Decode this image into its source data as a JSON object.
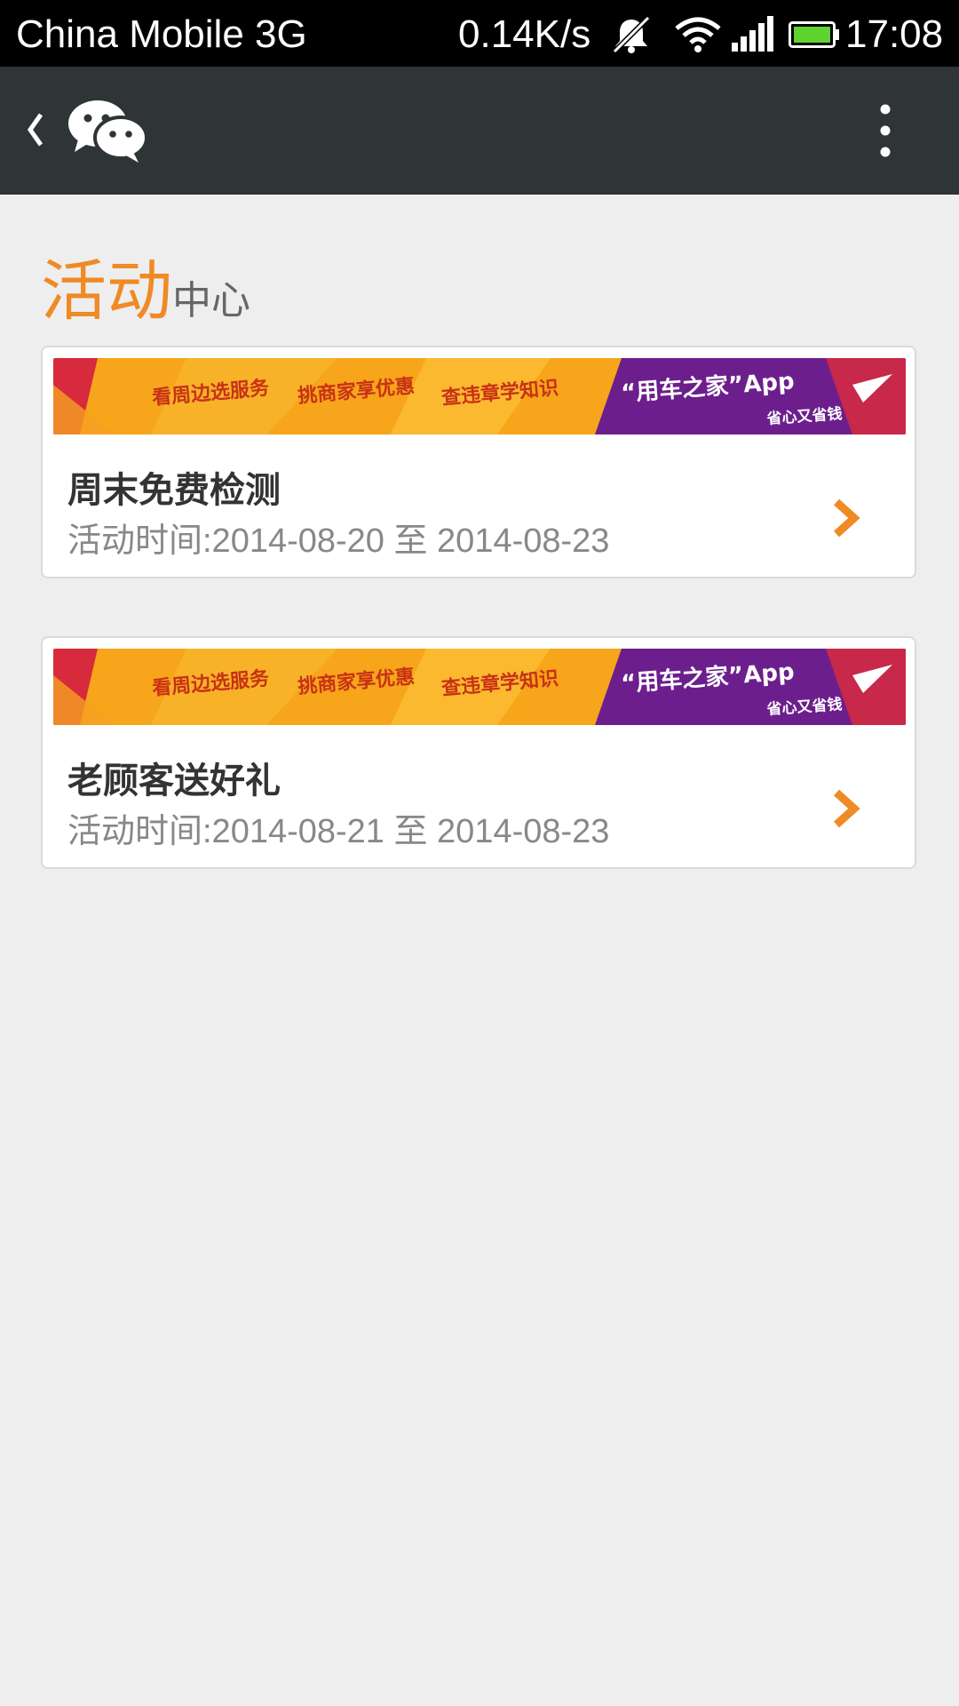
{
  "status_bar": {
    "carrier": "China Mobile 3G",
    "speed": "0.14K/s",
    "time": "17:08",
    "icons": [
      "mute-icon",
      "wifi-icon",
      "signal-icon",
      "battery-icon"
    ]
  },
  "app_bar": {
    "back_icon": "chevron-left-icon",
    "logo_icon": "wechat-icon",
    "menu_icon": "more-vertical-icon"
  },
  "section": {
    "title_highlight": "活动",
    "title_rest": "中心",
    "accent_color": "#ef8a25"
  },
  "banner": {
    "item1": "看周边选服务",
    "item2": "挑商家享优惠",
    "item3": "查违章学知识",
    "brand": "“用车之家”App",
    "slogan": "省心又省钱"
  },
  "activities": [
    {
      "title": "周末免费检测",
      "date": "活动时间:2014-08-20 至 2014-08-23"
    },
    {
      "title": "老顾客送好礼",
      "date": "活动时间:2014-08-21 至 2014-08-23"
    }
  ]
}
